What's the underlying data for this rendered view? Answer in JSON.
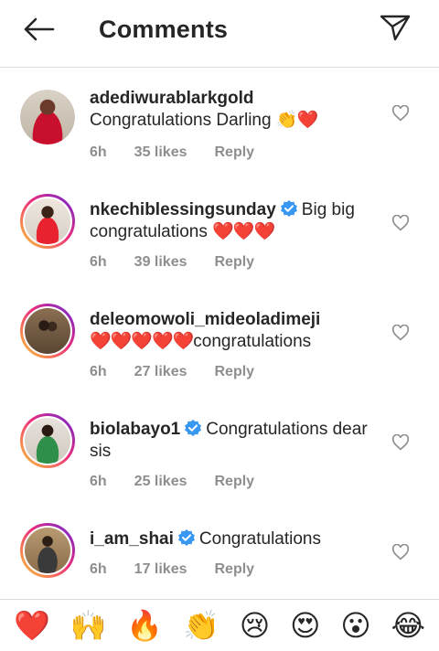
{
  "header": {
    "title": "Comments",
    "back_icon": "arrow-left-icon",
    "share_icon": "paper-plane-icon"
  },
  "colors": {
    "text": "#262626",
    "muted": "#8e8e8e",
    "divider": "#dbdbdb",
    "verified": "#3897f0",
    "heart": "#e0112b"
  },
  "comments": [
    {
      "username": "adediwurablarkgold",
      "verified": false,
      "text": "Congratulations Darling ",
      "emoji": "👏❤️",
      "time": "6h",
      "likes": "35 likes",
      "reply": "Reply",
      "avatar_ring": false
    },
    {
      "username": "nkechiblessingsunday",
      "verified": true,
      "text": "Big big congratulations ",
      "emoji": "❤️❤️❤️",
      "time": "6h",
      "likes": "39 likes",
      "reply": "Reply",
      "avatar_ring": true
    },
    {
      "username": "deleomowoli_mideoladimeji",
      "verified": false,
      "text": "congratulations",
      "emoji": "❤️❤️❤️❤️❤️",
      "time": "6h",
      "likes": "27 likes",
      "reply": "Reply",
      "avatar_ring": true
    },
    {
      "username": "biolabayo1",
      "verified": true,
      "text": "Congratulations dear sis",
      "emoji": "",
      "time": "6h",
      "likes": "25 likes",
      "reply": "Reply",
      "avatar_ring": true
    },
    {
      "username": "i_am_shai",
      "verified": true,
      "text": "Congratulations",
      "emoji": "",
      "time": "6h",
      "likes": "17 likes",
      "reply": "Reply",
      "avatar_ring": true
    }
  ],
  "emoji_bar": [
    "❤️",
    "🙌",
    "🔥",
    "👏",
    "😢",
    "😍",
    "😮",
    "😂"
  ]
}
